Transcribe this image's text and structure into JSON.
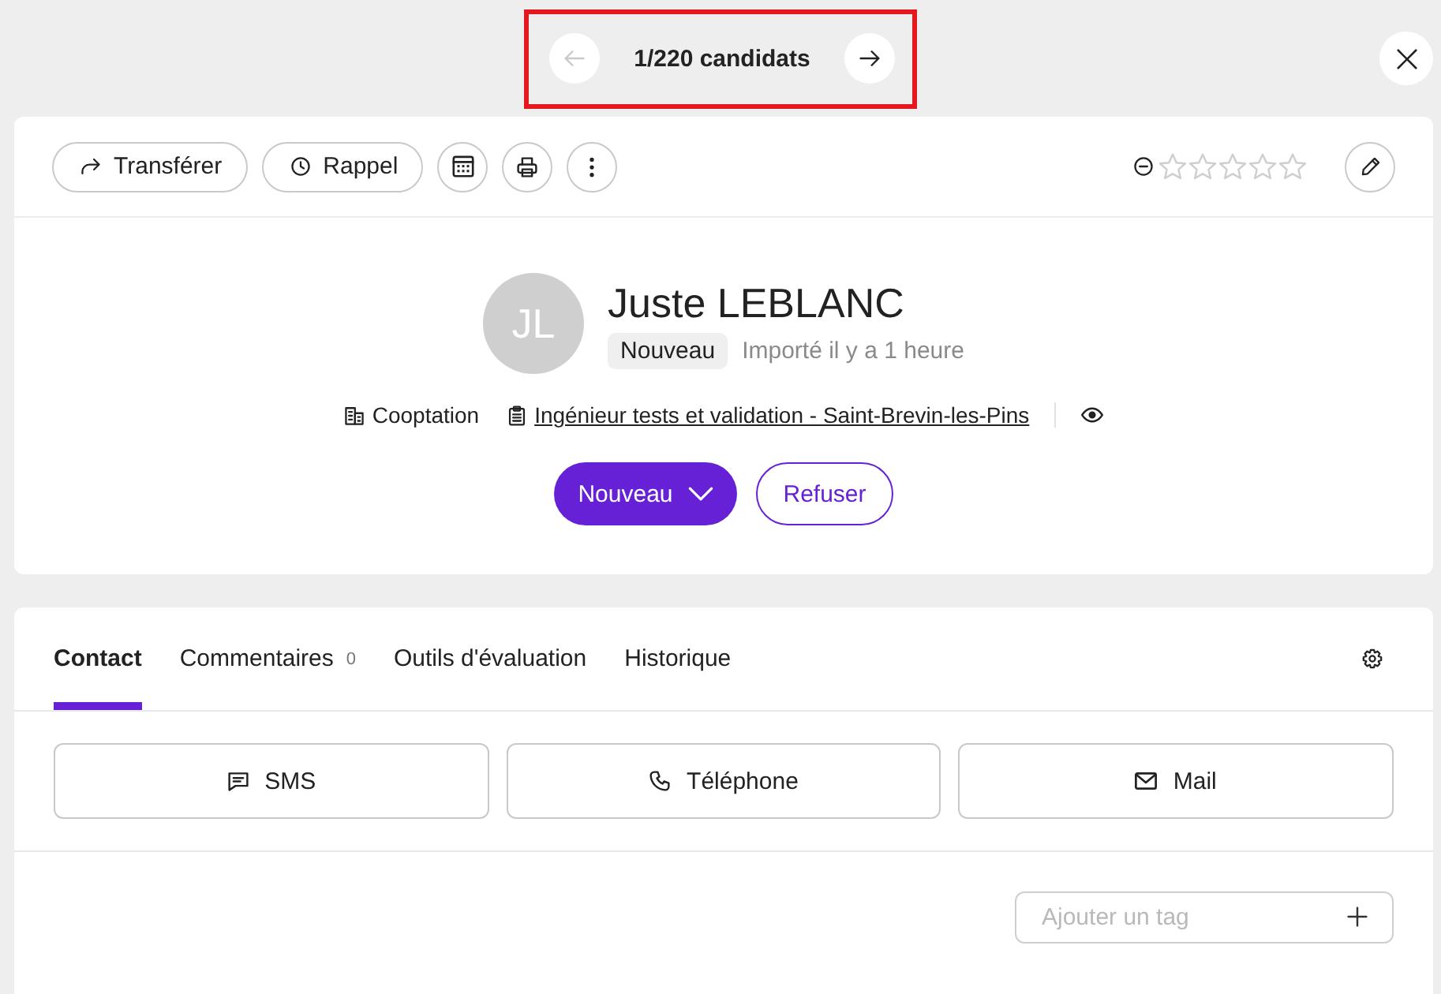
{
  "navigation": {
    "previous": {
      "disabled": true
    },
    "counter": "1/220 candidats",
    "next": {
      "disabled": false
    }
  },
  "toolbar": {
    "buttons": [
      {
        "label": "Transférer"
      },
      {
        "label": "Rappel"
      }
    ],
    "stars": 0
  },
  "profile": {
    "initials": "JL",
    "name": "Juste LEBLANC",
    "status_badge": "Nouveau",
    "imported": "Importé il y a 1 heure",
    "source": "Cooptation",
    "job_link": "Ingénieur tests et validation - Saint-Brevin-les-Pins"
  },
  "actions": {
    "status_button": "Nouveau",
    "reject_button": "Refuser"
  },
  "tabs": [
    {
      "label": "Contact",
      "selected": true
    },
    {
      "label": "Commentaires",
      "count": "0",
      "selected": false
    },
    {
      "label": "Outils d'évaluation",
      "selected": false
    },
    {
      "label": "Historique",
      "selected": false
    }
  ],
  "contact_buttons": [
    {
      "label": "SMS"
    },
    {
      "label": "Téléphone"
    },
    {
      "label": "Mail"
    }
  ],
  "tag_field": {
    "placeholder": "Ajouter un tag"
  }
}
